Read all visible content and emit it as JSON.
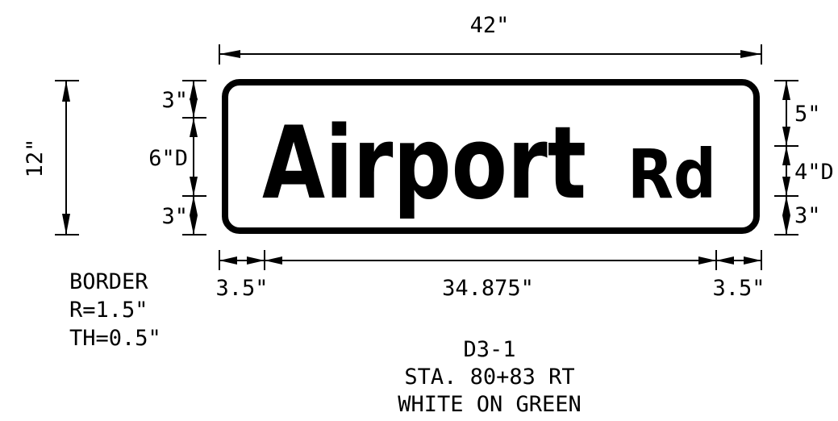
{
  "sign": {
    "legend_main": "Airport",
    "legend_suffix": "Rd"
  },
  "dimensions": {
    "overall_width": "42\"",
    "overall_height": "12\"",
    "left_top_margin": "3\"",
    "left_letter_height": "6\"D",
    "left_bottom_margin": "3\"",
    "right_top_margin": "5\"",
    "right_letter_height": "4\"D",
    "right_bottom_margin": "3\"",
    "left_side_margin": "3.5\"",
    "legend_width": "34.875\"",
    "right_side_margin": "3.5\""
  },
  "border_note": {
    "line1": "BORDER",
    "line2": "R=1.5\"",
    "line3": "TH=0.5\""
  },
  "sign_info": {
    "code": "D3-1",
    "station": "STA. 80+83 RT",
    "colors": "WHITE ON GREEN"
  }
}
